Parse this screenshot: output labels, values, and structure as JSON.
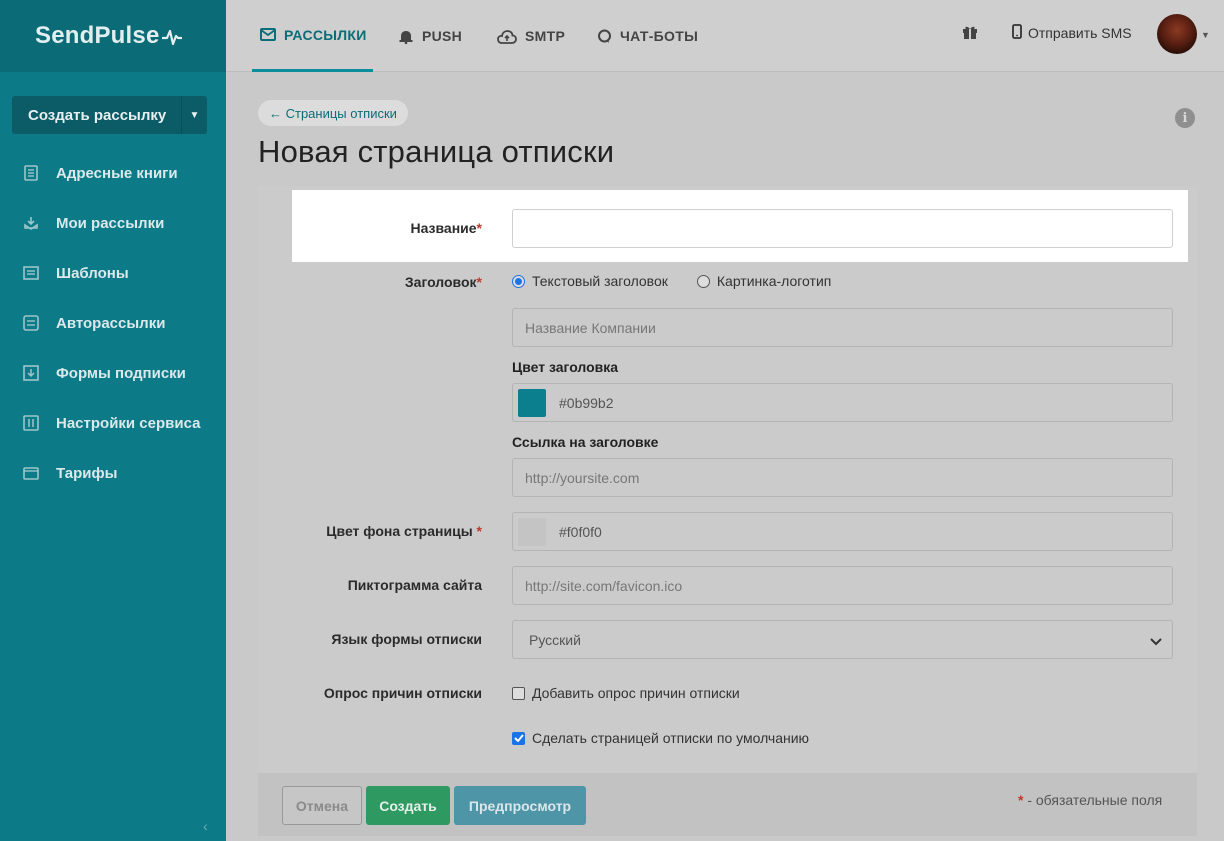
{
  "brand": {
    "name": "SendPulse"
  },
  "sidebar": {
    "create_button": "Создать рассылку",
    "items": [
      {
        "label": "Адресные книги",
        "icon": "address-book-icon"
      },
      {
        "label": "Мои рассылки",
        "icon": "campaigns-icon"
      },
      {
        "label": "Шаблоны",
        "icon": "templates-icon"
      },
      {
        "label": "Авторассылки",
        "icon": "automation-icon"
      },
      {
        "label": "Формы подписки",
        "icon": "subscription-form-icon"
      },
      {
        "label": "Настройки сервиса",
        "icon": "settings-icon"
      },
      {
        "label": "Тарифы",
        "icon": "wallet-icon"
      }
    ]
  },
  "topnav": {
    "tabs": [
      {
        "label": "РАССЫЛКИ",
        "icon": "envelope-icon",
        "active": true
      },
      {
        "label": "PUSH",
        "icon": "bell-icon"
      },
      {
        "label": "SMTP",
        "icon": "cloud-upload-icon"
      },
      {
        "label": "ЧАТ-БОТЫ",
        "icon": "chat-icon"
      }
    ],
    "sms_label": "Отправить SMS"
  },
  "page": {
    "breadcrumb": "← Страницы отписки",
    "title": "Новая страница отписки"
  },
  "form": {
    "name_label": "Название",
    "name_value": "",
    "header_label": "Заголовок",
    "header_options": [
      "Текстовый заголовок",
      "Картинка-логотип"
    ],
    "header_selected": "Текстовый заголовок",
    "company_placeholder": "Название Компании",
    "header_color_label": "Цвет заголовка",
    "header_color": "#0b99b2",
    "header_link_label": "Ссылка на заголовке",
    "header_link_placeholder": "http://yoursite.com",
    "bg_color_label": "Цвет фона страницы",
    "bg_color": "#f0f0f0",
    "favicon_label": "Пиктограмма сайта",
    "favicon_placeholder": "http://site.com/favicon.ico",
    "language_label": "Язык формы отписки",
    "language_value": "Русский",
    "survey_label": "Опрос причин отписки",
    "survey_checkbox": "Добавить опрос причин отписки",
    "survey_checked": false,
    "default_checkbox": "Сделать страницей отписки по умолчанию",
    "default_checked": true,
    "required_mark": "*"
  },
  "footer": {
    "cancel": "Отмена",
    "create": "Создать",
    "preview": "Предпросмотр",
    "required_note": " - обязательные поля"
  },
  "colors": {
    "sidebar": "#0c7a87",
    "accent": "#0b8d9b",
    "create_green": "#2e9a62",
    "preview_blue": "#4f95a8",
    "required_red": "#c0392b"
  }
}
